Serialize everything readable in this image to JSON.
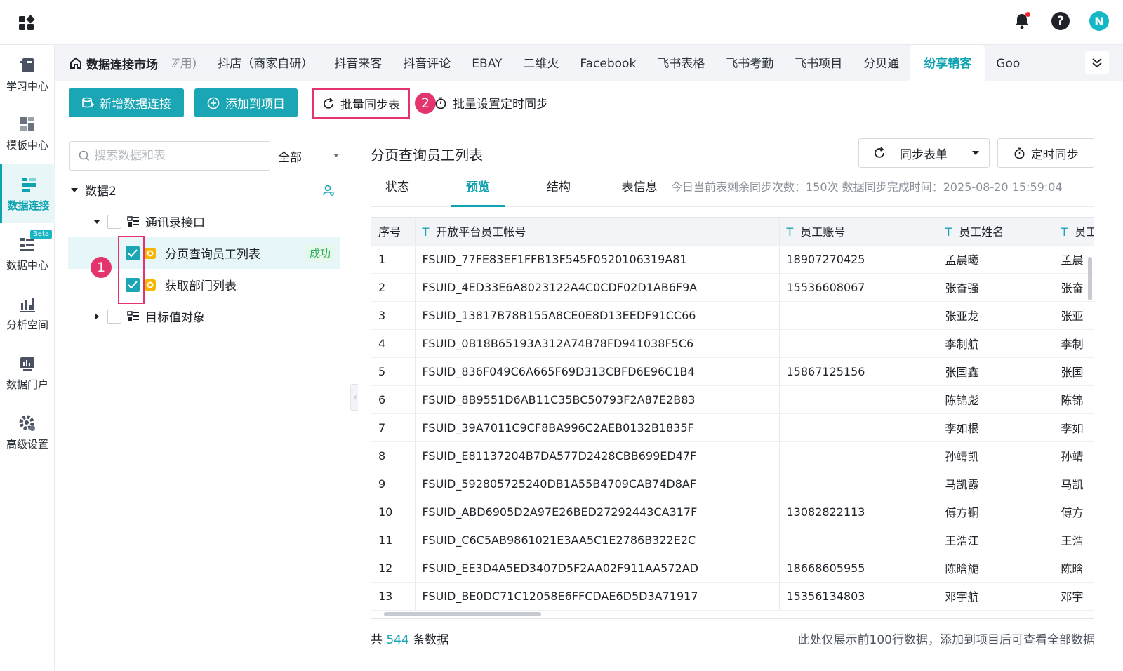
{
  "topbar": {
    "apps_icon": "apps-grid-icon",
    "avatar_letter": "N",
    "accent": "#1aa6b4"
  },
  "leftnav": {
    "items": [
      {
        "label": "学习中心",
        "icon": "book-icon"
      },
      {
        "label": "模板中心",
        "icon": "template-icon"
      },
      {
        "label": "数据连接",
        "icon": "data-connect-icon",
        "active": true
      },
      {
        "label": "数据中心",
        "icon": "data-center-icon",
        "badge": "Beta"
      },
      {
        "label": "分析空间",
        "icon": "analysis-icon"
      },
      {
        "label": "数据门户",
        "icon": "portal-icon"
      },
      {
        "label": "高级设置",
        "icon": "gear-icon"
      }
    ]
  },
  "tabstrip": {
    "home_label": "数据连接市场",
    "tabs": [
      "ℤ用)",
      "抖店（商家自研）",
      "抖音来客",
      "抖音评论",
      "EBAY",
      "二维火",
      "Facebook",
      "飞书表格",
      "飞书考勤",
      "飞书项目",
      "分贝通",
      "纷享销客",
      "Goo"
    ],
    "active_tab": "纷享销客"
  },
  "toolbar": {
    "add_connection": "新增数据连接",
    "add_to_project": "添加到项目",
    "batch_sync": "批量同步表",
    "batch_schedule": "批量设置定时同步",
    "marker_2": "2"
  },
  "tree": {
    "search_placeholder": "搜索数据和表",
    "filter_value": "全部",
    "root": "数据2",
    "group1": "通讯录接口",
    "item1": "分页查询员工列表",
    "item1_status": "成功",
    "item2": "获取部门列表",
    "group2": "目标值对象",
    "marker_1": "1"
  },
  "content": {
    "title": "分页查询员工列表",
    "sync_button": "同步表单",
    "timer_button": "定时同步",
    "subtabs": [
      "状态",
      "预览",
      "结构",
      "表信息"
    ],
    "active_subtab": "预览",
    "sync_info": "今日当前表剩余同步次数：150次   数据同步完成时间：2025-08-20 15:59:04",
    "columns": [
      "序号",
      "开放平台员工帐号",
      "员工账号",
      "员工姓名",
      "员工"
    ],
    "column_type_icon": "T",
    "rows": [
      [
        "1",
        "FSUID_77FE83EF1FFB13F545F0520106319A81",
        "18907270425",
        "孟晨曦",
        "孟晨"
      ],
      [
        "2",
        "FSUID_4ED33E6A8023122A4C0CDF02D1AB6F9A",
        "15536608067",
        "张奋强",
        "张奋"
      ],
      [
        "3",
        "FSUID_13817B78B155A8CE0E8D13EEDF91CC66",
        "",
        "张亚龙",
        "张亚"
      ],
      [
        "4",
        "FSUID_0B18B65193A312A74B78FD941038F5C6",
        "",
        "李制航",
        "李制"
      ],
      [
        "5",
        "FSUID_836F049C6A665F69D313CBFD6E96C1B4",
        "15867125156",
        "张国鑫",
        "张国"
      ],
      [
        "6",
        "FSUID_8B9551D6AB11C35BC50793F2A87E2B83",
        "",
        "陈锦彪",
        "陈锦"
      ],
      [
        "7",
        "FSUID_39A7011C9CF8BA996C2AEB0132B1835F",
        "",
        "李如根",
        "李如"
      ],
      [
        "8",
        "FSUID_E81137204B7DA577D2428CBB699ED47F",
        "",
        "孙靖凯",
        "孙靖"
      ],
      [
        "9",
        "FSUID_592805725240DB1A55B4709CAB74D8AF",
        "",
        "马凯霞",
        "马凯"
      ],
      [
        "10",
        "FSUID_ABD6905D2A97E26BED27292443CA317F",
        "13082822113",
        "傅方铜",
        "傅方"
      ],
      [
        "11",
        "FSUID_C6C5AB9861021E3AA5C1E2786B322E2C",
        "",
        "王浩江",
        "王浩"
      ],
      [
        "12",
        "FSUID_EE3D4A5ED3407D5F2AA02F911AA572AD",
        "18668605955",
        "陈晗旎",
        "陈晗"
      ],
      [
        "13",
        "FSUID_BE0DC71C12058E6FFCDAE6D5D3A71917",
        "15356134803",
        "邓宇航",
        "邓宇"
      ]
    ],
    "footer_prefix": "共",
    "footer_count": "544",
    "footer_suffix": "条数据",
    "footer_note": "此处仅展示前100行数据，添加到项目后可查看全部数据"
  }
}
